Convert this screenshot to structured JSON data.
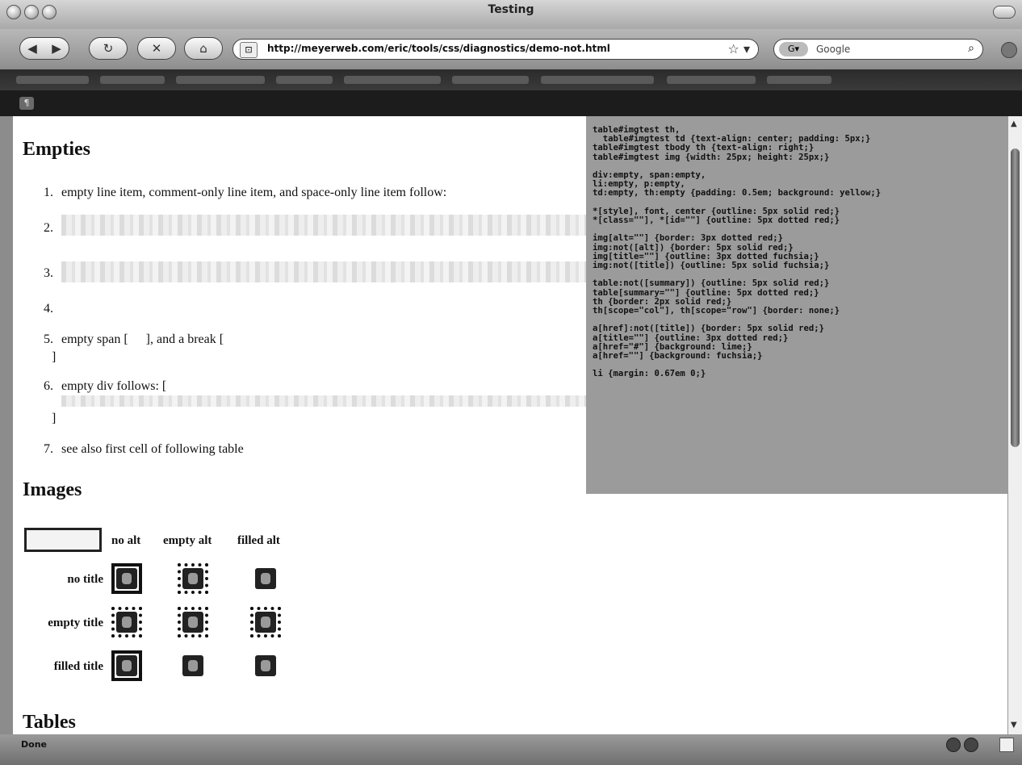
{
  "window": {
    "title": "Testing"
  },
  "toolbar": {
    "back_glyph": "◀",
    "forward_glyph": "▶",
    "reload_glyph": "↻",
    "stop_glyph": "✕",
    "home_glyph": "⌂",
    "url": "http://meyerweb.com/eric/tools/css/diagnostics/demo-not.html",
    "star_glyph": "☆ ▾",
    "search_engine_glyph": "G▾",
    "search_placeholder": "Google",
    "search_glyph": "⌕"
  },
  "devbar": {
    "icon_glyph": "¶"
  },
  "content": {
    "empties": {
      "heading": "Empties",
      "items": [
        {
          "num": "1.",
          "text": "empty line item, comment-only line item, and space-only line item follow:"
        },
        {
          "num": "2.",
          "text": ""
        },
        {
          "num": "3.",
          "text": ""
        },
        {
          "num": "4.",
          "text": ""
        },
        {
          "num": "5.",
          "text_a": "empty span [",
          "text_b": "], and a break [",
          "text_c": "]"
        },
        {
          "num": "6.",
          "text_a": "empty div follows: [",
          "text_c": "]"
        },
        {
          "num": "7.",
          "text": "see also first cell of following table"
        }
      ]
    },
    "images": {
      "heading": "Images",
      "col_headers": [
        "no alt",
        "empty alt",
        "filled alt"
      ],
      "row_headers": [
        "no title",
        "empty title",
        "filled title"
      ]
    },
    "tables": {
      "heading": "Tables"
    }
  },
  "css_panel": {
    "code": "table#imgtest th,\n  table#imgtest td {text-align: center; padding: 5px;}\ntable#imgtest tbody th {text-align: right;}\ntable#imgtest img {width: 25px; height: 25px;}\n\ndiv:empty, span:empty,\nli:empty, p:empty,\ntd:empty, th:empty {padding: 0.5em; background: yellow;}\n\n*[style], font, center {outline: 5px solid red;}\n*[class=\"\"], *[id=\"\"] {outline: 5px dotted red;}\n\nimg[alt=\"\"] {border: 3px dotted red;}\nimg:not([alt]) {border: 5px solid red;}\nimg[title=\"\"] {outline: 3px dotted fuchsia;}\nimg:not([title]) {outline: 5px solid fuchsia;}\n\ntable:not([summary]) {outline: 5px solid red;}\ntable[summary=\"\"] {outline: 5px dotted red;}\nth {border: 2px solid red;}\nth[scope=\"col\"], th[scope=\"row\"] {border: none;}\n\na[href]:not([title]) {border: 5px solid red;}\na[title=\"\"] {outline: 3px dotted red;}\na[href=\"#\"] {background: lime;}\na[href=\"\"] {background: fuchsia;}\n\nli {margin: 0.67em 0;}"
  },
  "statusbar": {
    "text": "Done"
  },
  "scrollbar": {
    "up_glyph": "▲",
    "down_glyph": "▼"
  }
}
